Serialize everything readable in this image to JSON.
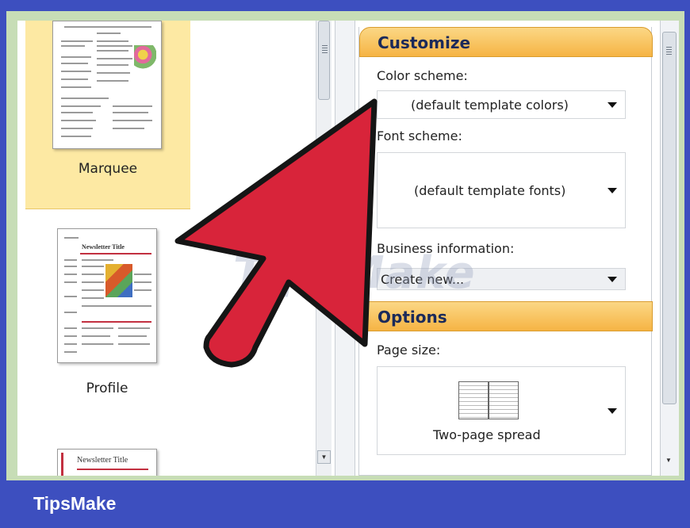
{
  "templates": {
    "items": [
      {
        "label": "Marquee",
        "selected": true
      },
      {
        "label": "Profile",
        "selected": false
      },
      {
        "label": "",
        "thumb_title": "Newsletter Title"
      }
    ],
    "profile_thumb_title": "Newsletter Title"
  },
  "customize": {
    "heading": "Customize",
    "color_scheme": {
      "label": "Color scheme:",
      "value": "(default template colors)"
    },
    "font_scheme": {
      "label": "Font scheme:",
      "value": "(default template fonts)"
    },
    "business_info": {
      "label": "Business information:",
      "value": "Create new..."
    }
  },
  "options": {
    "heading": "Options",
    "page_size": {
      "label": "Page size:",
      "value": "Two-page spread"
    }
  },
  "watermark": "TipsMake",
  "brand": "TipsMake",
  "colors": {
    "accent": "#f6b444",
    "selected_bg": "#fde9a3",
    "arrow_red": "#d8243a",
    "banner_blue": "#3d4fbf"
  },
  "icons": [
    "dropdown-caret-icon",
    "scrollbar-grip-icon",
    "two-page-spread-icon",
    "pointer-arrow-icon"
  ]
}
